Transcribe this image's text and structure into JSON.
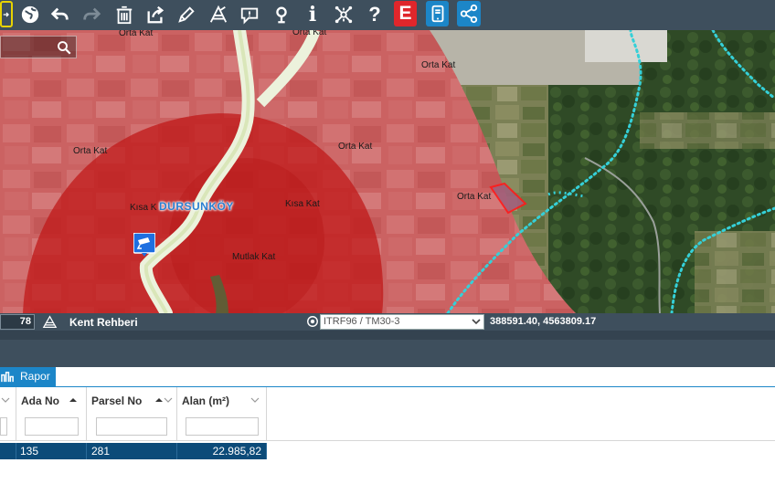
{
  "toolbar": {
    "icons": [
      "login-icon",
      "globe-icon",
      "undo-icon",
      "redo-icon",
      "trash-icon",
      "share-out-icon",
      "pencil-icon",
      "measure-icon",
      "comment-icon",
      "location-pin-icon",
      "info-icon",
      "network-icon",
      "help-icon",
      "e-badge-icon",
      "mobile-icon",
      "share-icon"
    ],
    "help_glyph": "?",
    "info_glyph": "i",
    "e_glyph": "E",
    "accent_red": "#e0262b",
    "accent_blue": "#1c86c8"
  },
  "map": {
    "labels": {
      "orta1": "Orta Kat",
      "orta2": "Orta Kat",
      "orta3": "Orta Kat",
      "orta4": "Orta Kat",
      "orta5": "Orta Kat",
      "orta6": "Orta Kat",
      "kisa1": "Kısa K",
      "kisa2": "Kısa Kat",
      "mutlak": "Mutlak Kat",
      "village": "DURSUNKÖY"
    },
    "search_value": ""
  },
  "status": {
    "scale": "78",
    "app_name": "Kent Rehberi",
    "crs": "ITRF96 / TM30-3",
    "coordinates": "388591.40, 4563809.17"
  },
  "report": {
    "tab_label": "Rapor",
    "columns": [
      "Ada No",
      "Parsel No",
      "Alan (m²)"
    ],
    "rows": [
      {
        "ada": "135",
        "parsel": "281",
        "alan": "22.985,82"
      }
    ]
  }
}
